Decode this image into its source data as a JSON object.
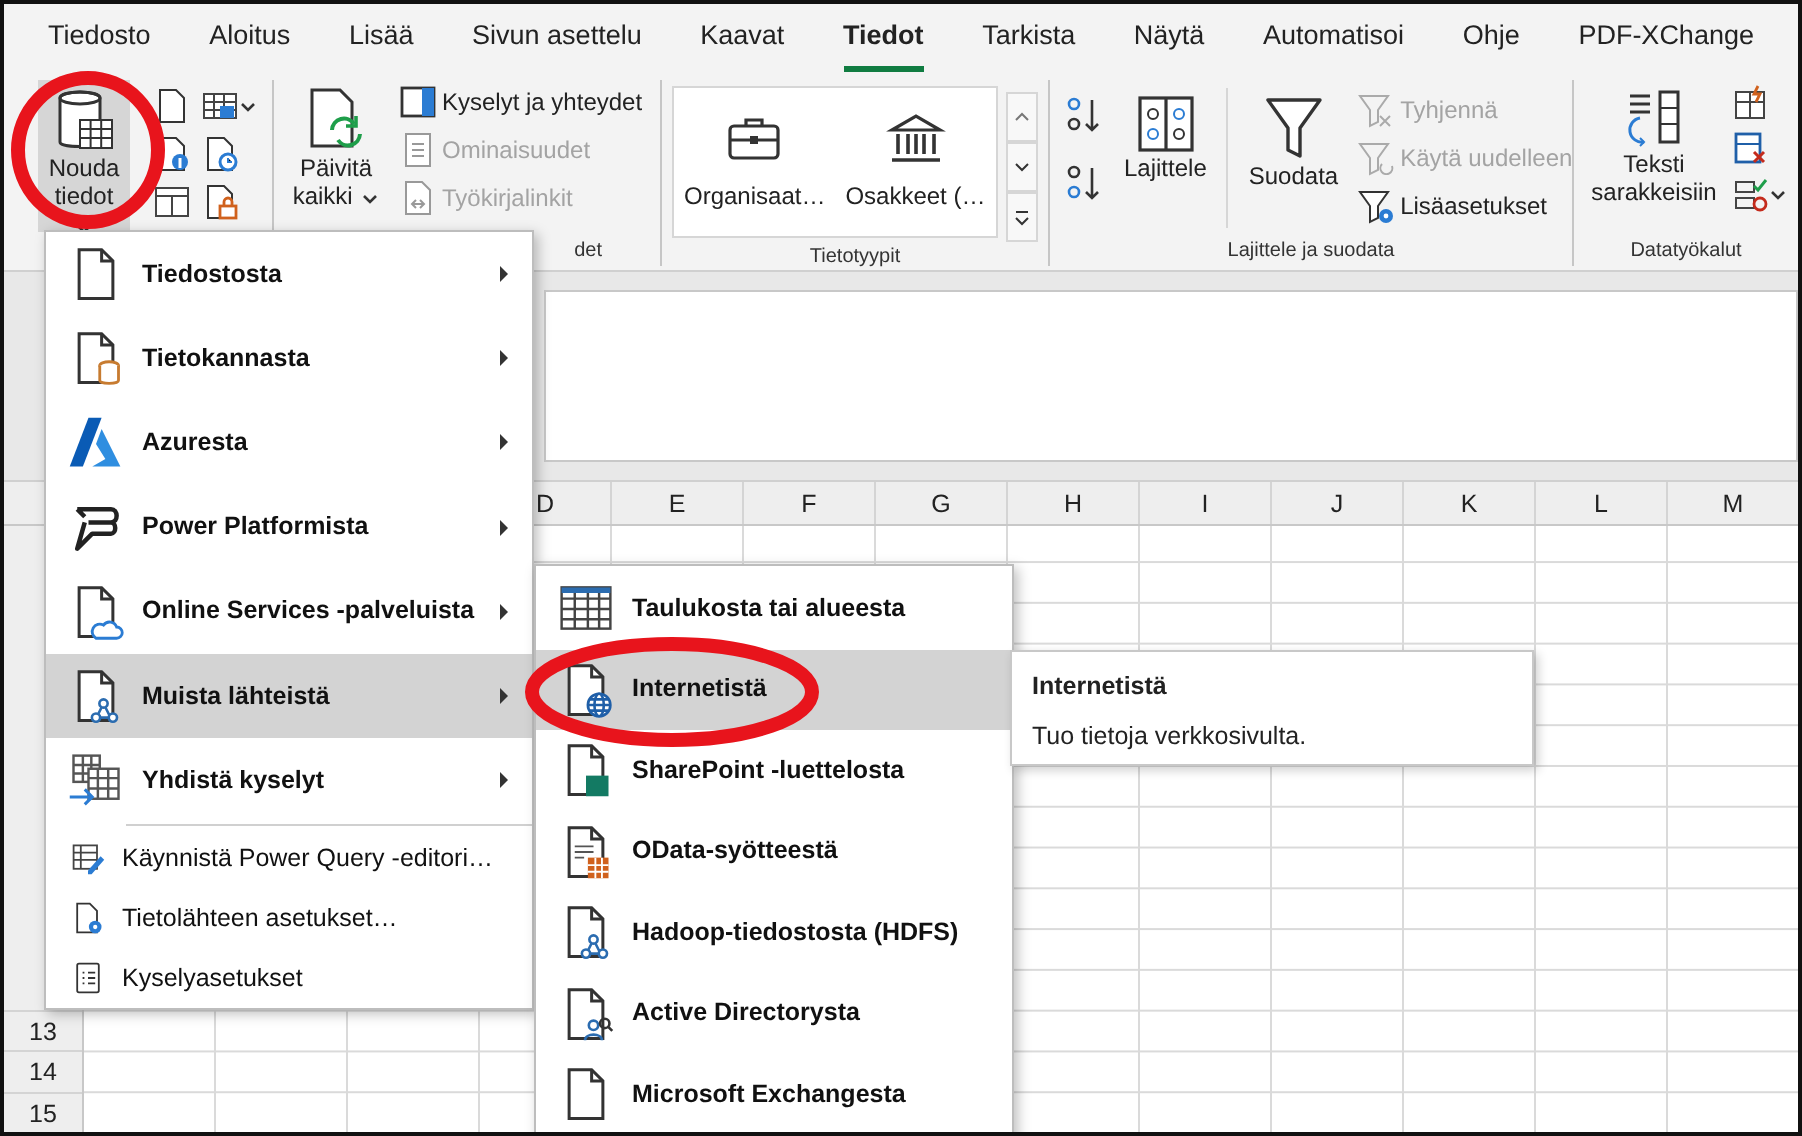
{
  "tabs": [
    {
      "label": "Tiedosto",
      "selected": false
    },
    {
      "label": "Aloitus",
      "selected": false
    },
    {
      "label": "Lisää",
      "selected": false
    },
    {
      "label": "Sivun asettelu",
      "selected": false
    },
    {
      "label": "Kaavat",
      "selected": false
    },
    {
      "label": "Tiedot",
      "selected": true
    },
    {
      "label": "Tarkista",
      "selected": false
    },
    {
      "label": "Näytä",
      "selected": false
    },
    {
      "label": "Automatisoi",
      "selected": false
    },
    {
      "label": "Ohje",
      "selected": false
    },
    {
      "label": "PDF-XChange",
      "selected": false
    }
  ],
  "ribbon": {
    "get_data": {
      "label": "Nouda tiedot",
      "pressed": true
    },
    "queries": {
      "refresh": "Päivitä kaikki",
      "commands": [
        {
          "label": "Kyselyt ja yhteydet",
          "disabled": false
        },
        {
          "label": "Ominaisuudet",
          "disabled": true
        },
        {
          "label": "Työkirjalinkit",
          "disabled": true
        }
      ],
      "group_label": "det"
    },
    "data_types": {
      "items": [
        "Organisaat…",
        "Osakkeet (…"
      ],
      "group_label": "Tietotyypit"
    },
    "sort_filter": {
      "sort": "Lajittele",
      "filter": "Suodata",
      "commands": [
        {
          "label": "Tyhjennä",
          "disabled": true
        },
        {
          "label": "Käytä uudelleen",
          "disabled": true
        },
        {
          "label": "Lisäasetukset",
          "disabled": false
        }
      ],
      "group_label": "Lajittele ja suodata"
    },
    "data_tools": {
      "button": "Teksti sarakkeisiin",
      "group_label": "Datatyökalut"
    }
  },
  "sheet": {
    "columns": [
      "D",
      "E",
      "F",
      "G",
      "H",
      "I",
      "J",
      "K",
      "L",
      "M"
    ],
    "row_numbers": [
      "13",
      "14",
      "15"
    ]
  },
  "data_menu": {
    "items": [
      {
        "label": "Tiedostosta",
        "kind": "large",
        "submenu": true,
        "selected": false
      },
      {
        "label": "Tietokannasta",
        "kind": "large",
        "submenu": true,
        "selected": false
      },
      {
        "label": "Azuresta",
        "kind": "large",
        "submenu": true,
        "selected": false
      },
      {
        "label": "Power Platformista",
        "kind": "large",
        "submenu": true,
        "selected": false
      },
      {
        "label": "Online Services -palveluista",
        "kind": "large",
        "submenu": true,
        "selected": false
      },
      {
        "label": "Muista lähteistä",
        "kind": "large",
        "submenu": true,
        "selected": true
      },
      {
        "label": "Yhdistä kyselyt",
        "kind": "large",
        "submenu": true,
        "selected": false
      },
      {
        "label": "Käynnistä Power Query -editori…",
        "kind": "small",
        "submenu": false,
        "selected": false
      },
      {
        "label": "Tietolähteen asetukset…",
        "kind": "small",
        "submenu": false,
        "selected": false
      },
      {
        "label": "Kyselyasetukset",
        "kind": "small",
        "submenu": false,
        "selected": false
      }
    ]
  },
  "submenu": {
    "items": [
      {
        "label": "Taulukosta tai alueesta",
        "selected": false
      },
      {
        "label": "Internetistä",
        "selected": true
      },
      {
        "label": "SharePoint -luettelosta",
        "selected": false
      },
      {
        "label": "OData-syötteestä",
        "selected": false
      },
      {
        "label": "Hadoop-tiedostosta (HDFS)",
        "selected": false
      },
      {
        "label": "Active Directorysta",
        "selected": false
      },
      {
        "label": "Microsoft Exchangesta",
        "selected": false
      }
    ]
  },
  "tooltip": {
    "title": "Internetistä",
    "text": "Tuo tietoja verkkosivulta."
  }
}
